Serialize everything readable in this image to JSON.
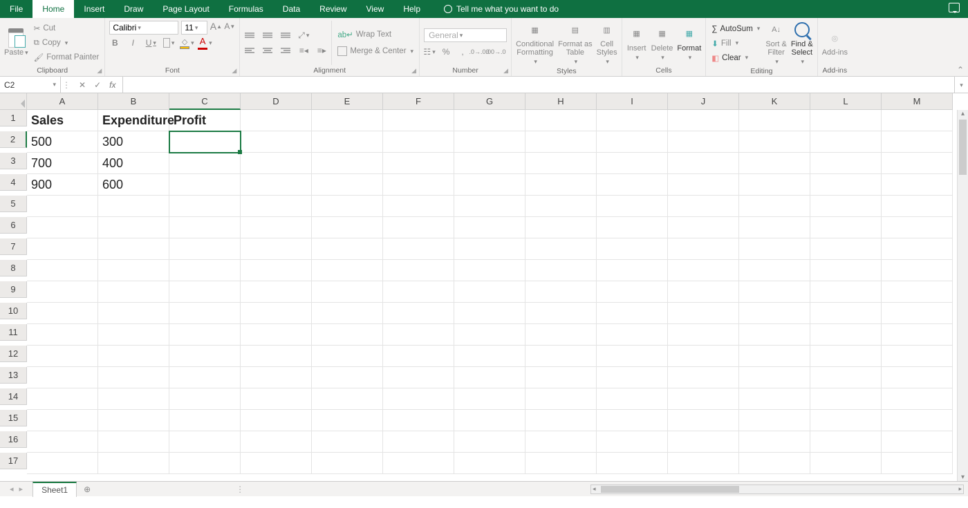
{
  "tabs": [
    "File",
    "Home",
    "Insert",
    "Draw",
    "Page Layout",
    "Formulas",
    "Data",
    "Review",
    "View",
    "Help"
  ],
  "active_tab": "Home",
  "tell_me": "Tell me what you want to do",
  "clipboard": {
    "cut": "Cut",
    "copy": "Copy",
    "painter": "Format Painter",
    "paste": "Paste",
    "label": "Clipboard"
  },
  "font": {
    "name": "Calibri",
    "size": "11",
    "label": "Font"
  },
  "alignment": {
    "wrap": "Wrap Text",
    "merge": "Merge & Center",
    "label": "Alignment"
  },
  "number": {
    "format": "General",
    "label": "Number"
  },
  "styles": {
    "cond": "Conditional\nFormatting",
    "table": "Format as\nTable",
    "cell": "Cell\nStyles",
    "label": "Styles"
  },
  "cells": {
    "insert": "Insert",
    "delete": "Delete",
    "format": "Format",
    "label": "Cells"
  },
  "editing": {
    "autosum": "AutoSum",
    "fill": "Fill",
    "clear": "Clear",
    "sort": "Sort &\nFilter",
    "find": "Find &\nSelect",
    "label": "Editing"
  },
  "addins": {
    "addins": "Add-ins",
    "label": "Add-ins"
  },
  "name_box": "C2",
  "formula_bar": "",
  "columns": [
    "A",
    "B",
    "C",
    "D",
    "E",
    "F",
    "G",
    "H",
    "I",
    "J",
    "K",
    "L",
    "M"
  ],
  "rows": [
    "1",
    "2",
    "3",
    "4",
    "5",
    "6",
    "7",
    "8",
    "9",
    "10",
    "11",
    "12",
    "13",
    "14",
    "15",
    "16",
    "17"
  ],
  "marked_col": 2,
  "marked_row": 1,
  "data": {
    "A1": "Sales",
    "B1": "Expenditure",
    "C1": "Profit",
    "A2": "500",
    "B2": "300",
    "A3": "700",
    "B3": "400",
    "A4": "900",
    "B4": "600"
  },
  "selected_cell": "C2",
  "header_row": 0,
  "sheet": "Sheet1"
}
